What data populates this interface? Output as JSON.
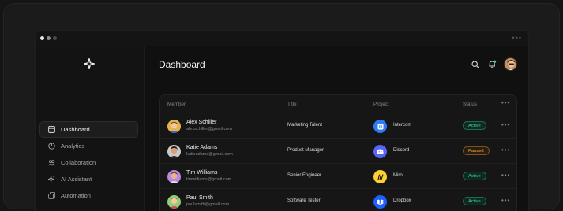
{
  "header": {
    "title": "Dashboard"
  },
  "sidebar": {
    "items": [
      {
        "label": "Dashboard",
        "icon": "layout-icon",
        "active": true
      },
      {
        "label": "Analytics",
        "icon": "pie-chart-icon",
        "active": false
      },
      {
        "label": "Collaboration",
        "icon": "users-icon",
        "active": false
      },
      {
        "label": "AI Assistant",
        "icon": "sparkle-icon",
        "active": false
      },
      {
        "label": "Automation",
        "icon": "layers-icon",
        "active": false
      }
    ]
  },
  "table": {
    "columns": [
      "Member",
      "Title",
      "Project",
      "Status"
    ],
    "rows": [
      {
        "name": "Alex Schiller",
        "email": "alexschiller@gmail.com",
        "title": "Marketing Talent",
        "project": "Intercom",
        "status": "Active",
        "project_color": "#2f7bf5",
        "avatar_color": "#e6b24a"
      },
      {
        "name": "Katie Adams",
        "email": "katieadams@gmail.com",
        "title": "Product Manager",
        "project": "Discord",
        "status": "Paused",
        "project_color": "#5865f2",
        "avatar_color": "#c9c9c9"
      },
      {
        "name": "Tim Williams",
        "email": "timwilliams@gmail.com",
        "title": "Senior Engineer",
        "project": "Miro",
        "status": "Active",
        "project_color": "#ffd02f",
        "avatar_color": "#b58ae0"
      },
      {
        "name": "Paul Smith",
        "email": "paulsmith@gmail.com",
        "title": "Software Tester",
        "project": "Dropbox",
        "status": "Active",
        "project_color": "#1f5fff",
        "avatar_color": "#8fcf7a"
      }
    ]
  },
  "colors": {
    "active": "#3fd39a",
    "paused": "#f0a64a",
    "background": "#101010"
  }
}
